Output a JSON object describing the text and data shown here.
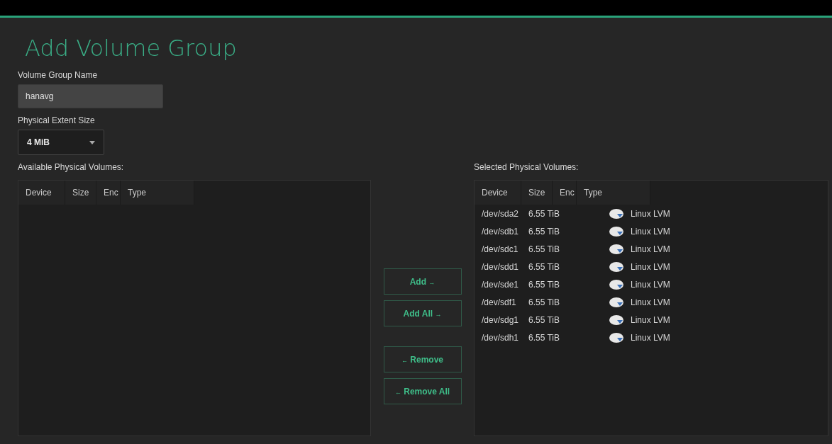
{
  "title": "Add Volume Group",
  "name_field": {
    "label": "Volume Group Name",
    "value": "hanavg"
  },
  "extent": {
    "label": "Physical Extent Size",
    "value": "4 MiB"
  },
  "available": {
    "label": "Available Physical Volumes:",
    "columns": [
      "Device",
      "Size",
      "Enc",
      "Type"
    ]
  },
  "buttons": [
    {
      "label": "Add",
      "arrow": "→",
      "kind": "forward"
    },
    {
      "label": "Add All",
      "arrow": "→",
      "kind": "forward"
    },
    {
      "label": "Remove",
      "arrow": "←",
      "kind": "back"
    },
    {
      "label": "Remove All",
      "arrow": "←",
      "kind": "back"
    }
  ],
  "selected": {
    "label": "Selected Physical Volumes:",
    "columns": [
      "Device",
      "Size",
      "Enc",
      "Type"
    ],
    "rows": [
      {
        "device": "/dev/sda2",
        "size": "6.55 TiB",
        "type": "Linux LVM"
      },
      {
        "device": "/dev/sdb1",
        "size": "6.55 TiB",
        "type": "Linux LVM"
      },
      {
        "device": "/dev/sdc1",
        "size": "6.55 TiB",
        "type": "Linux LVM"
      },
      {
        "device": "/dev/sdd1",
        "size": "6.55 TiB",
        "type": "Linux LVM"
      },
      {
        "device": "/dev/sde1",
        "size": "6.55 TiB",
        "type": "Linux LVM"
      },
      {
        "device": "/dev/sdf1",
        "size": "6.55 TiB",
        "type": "Linux LVM"
      },
      {
        "device": "/dev/sdg1",
        "size": "6.55 TiB",
        "type": "Linux LVM"
      },
      {
        "device": "/dev/sdh1",
        "size": "6.55 TiB",
        "type": "Linux LVM"
      }
    ]
  }
}
